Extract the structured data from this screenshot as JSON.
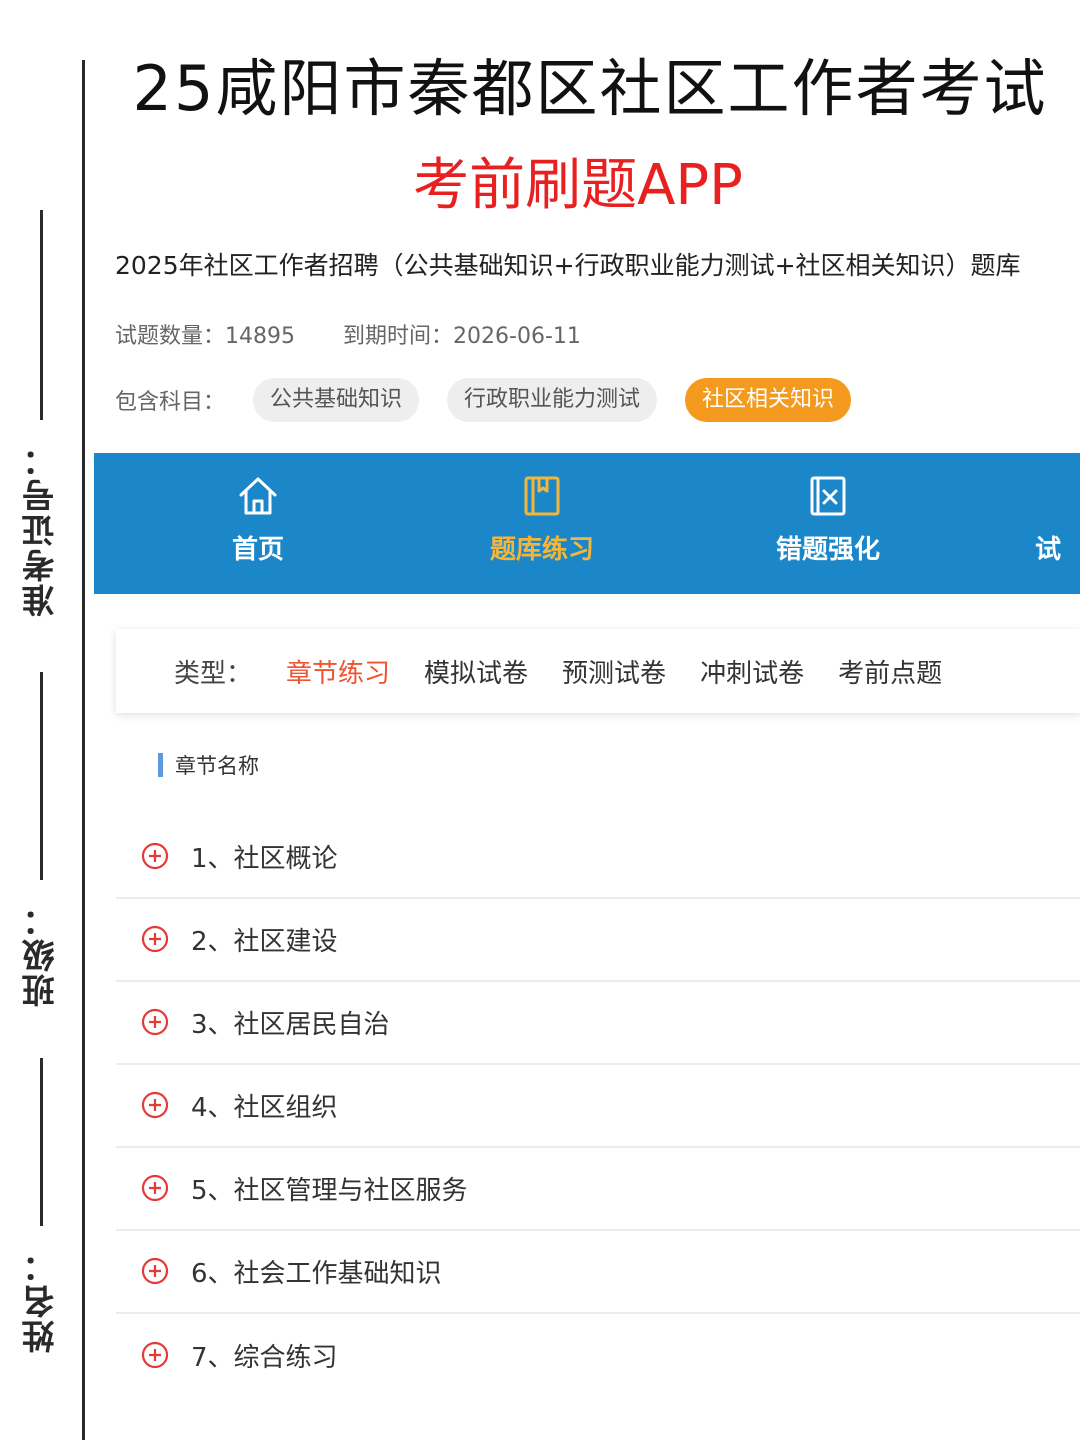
{
  "side_labels": {
    "exam_id": "准考证号：",
    "class": "班级：",
    "name": "姓名："
  },
  "header": {
    "title": "25咸阳市秦都区社区工作者考试",
    "subtitle": "考前刷题APP"
  },
  "bank": {
    "title": "2025年社区工作者招聘（公共基础知识+行政职业能力测试+社区相关知识）题库",
    "count_label": "试题数量：",
    "count_value": "14895",
    "expire_label": "到期时间：",
    "expire_value": "2026-06-11",
    "subjects_label": "包含科目：",
    "subjects": [
      "公共基础知识",
      "行政职业能力测试",
      "社区相关知识"
    ]
  },
  "nav": {
    "items": [
      {
        "label": "首页",
        "icon": "home-icon"
      },
      {
        "label": "题库练习",
        "icon": "book-icon",
        "active": true
      },
      {
        "label": "错题强化",
        "icon": "error-book-icon"
      },
      {
        "label": "试",
        "icon": ""
      }
    ],
    "bg_color": "#1b87c9",
    "active_color": "#f4b63a"
  },
  "types": {
    "label": "类型：",
    "tabs": [
      "章节练习",
      "模拟试卷",
      "预测试卷",
      "冲刺试卷",
      "考前点题"
    ],
    "active_index": 0,
    "active_color": "#f0532d"
  },
  "chapters": {
    "heading": "章节名称",
    "items": [
      "1、社区概论",
      "2、社区建设",
      "3、社区居民自治",
      "4、社区组织",
      "5、社区管理与社区服务",
      "6、社会工作基础知识",
      "7、综合练习"
    ],
    "icon": "plus-circle-icon",
    "icon_color": "#e53935"
  }
}
